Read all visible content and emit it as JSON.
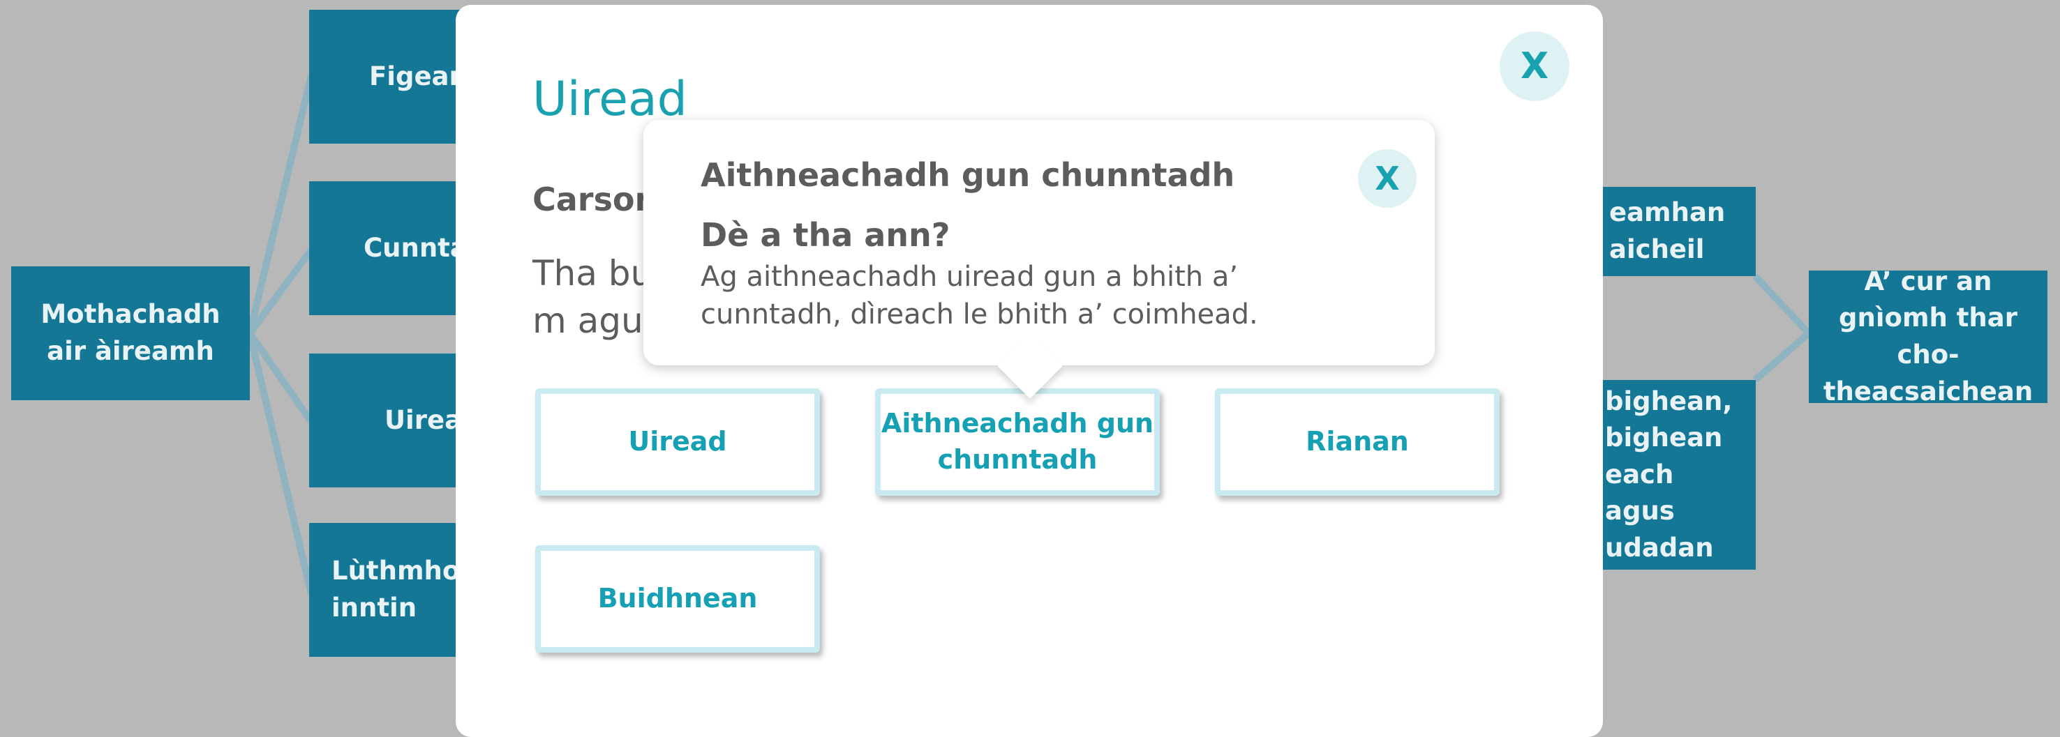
{
  "background_map": {
    "root": "Mothachadh air àireamh",
    "left_branches": [
      "Figeara",
      "Cunnta",
      "Uirea",
      "Lùthmhor inntin"
    ],
    "right_branches": [
      "eamhan aicheil",
      "bighean, bighean each agus udadan"
    ],
    "goal": "A’ cur an gnìomh thar cho-theacsaichean"
  },
  "modal": {
    "title": "Uiread",
    "heading": "Carson",
    "body": "Tha bu                                                                                    m agus àir",
    "close_label": "X",
    "options": [
      {
        "label": "Uiread"
      },
      {
        "label": "Aithneachadh gun chunntadh"
      },
      {
        "label": "Rianan"
      },
      {
        "label": "Buidhnean"
      }
    ]
  },
  "tooltip": {
    "title": "Aithneachadh gun chunntadh",
    "subtitle": "Dè a tha ann?",
    "body": "Ag aithneachadh uiread gun a bhith a’ cunntadh, dìreach le bhith a’ coimhead.",
    "close_label": "X"
  },
  "colors": {
    "overlay": "#b8b8b8",
    "node": "#137795",
    "accent": "#1aa1b0",
    "text": "#5c5c5c",
    "option_border": "#c8eaf0"
  }
}
